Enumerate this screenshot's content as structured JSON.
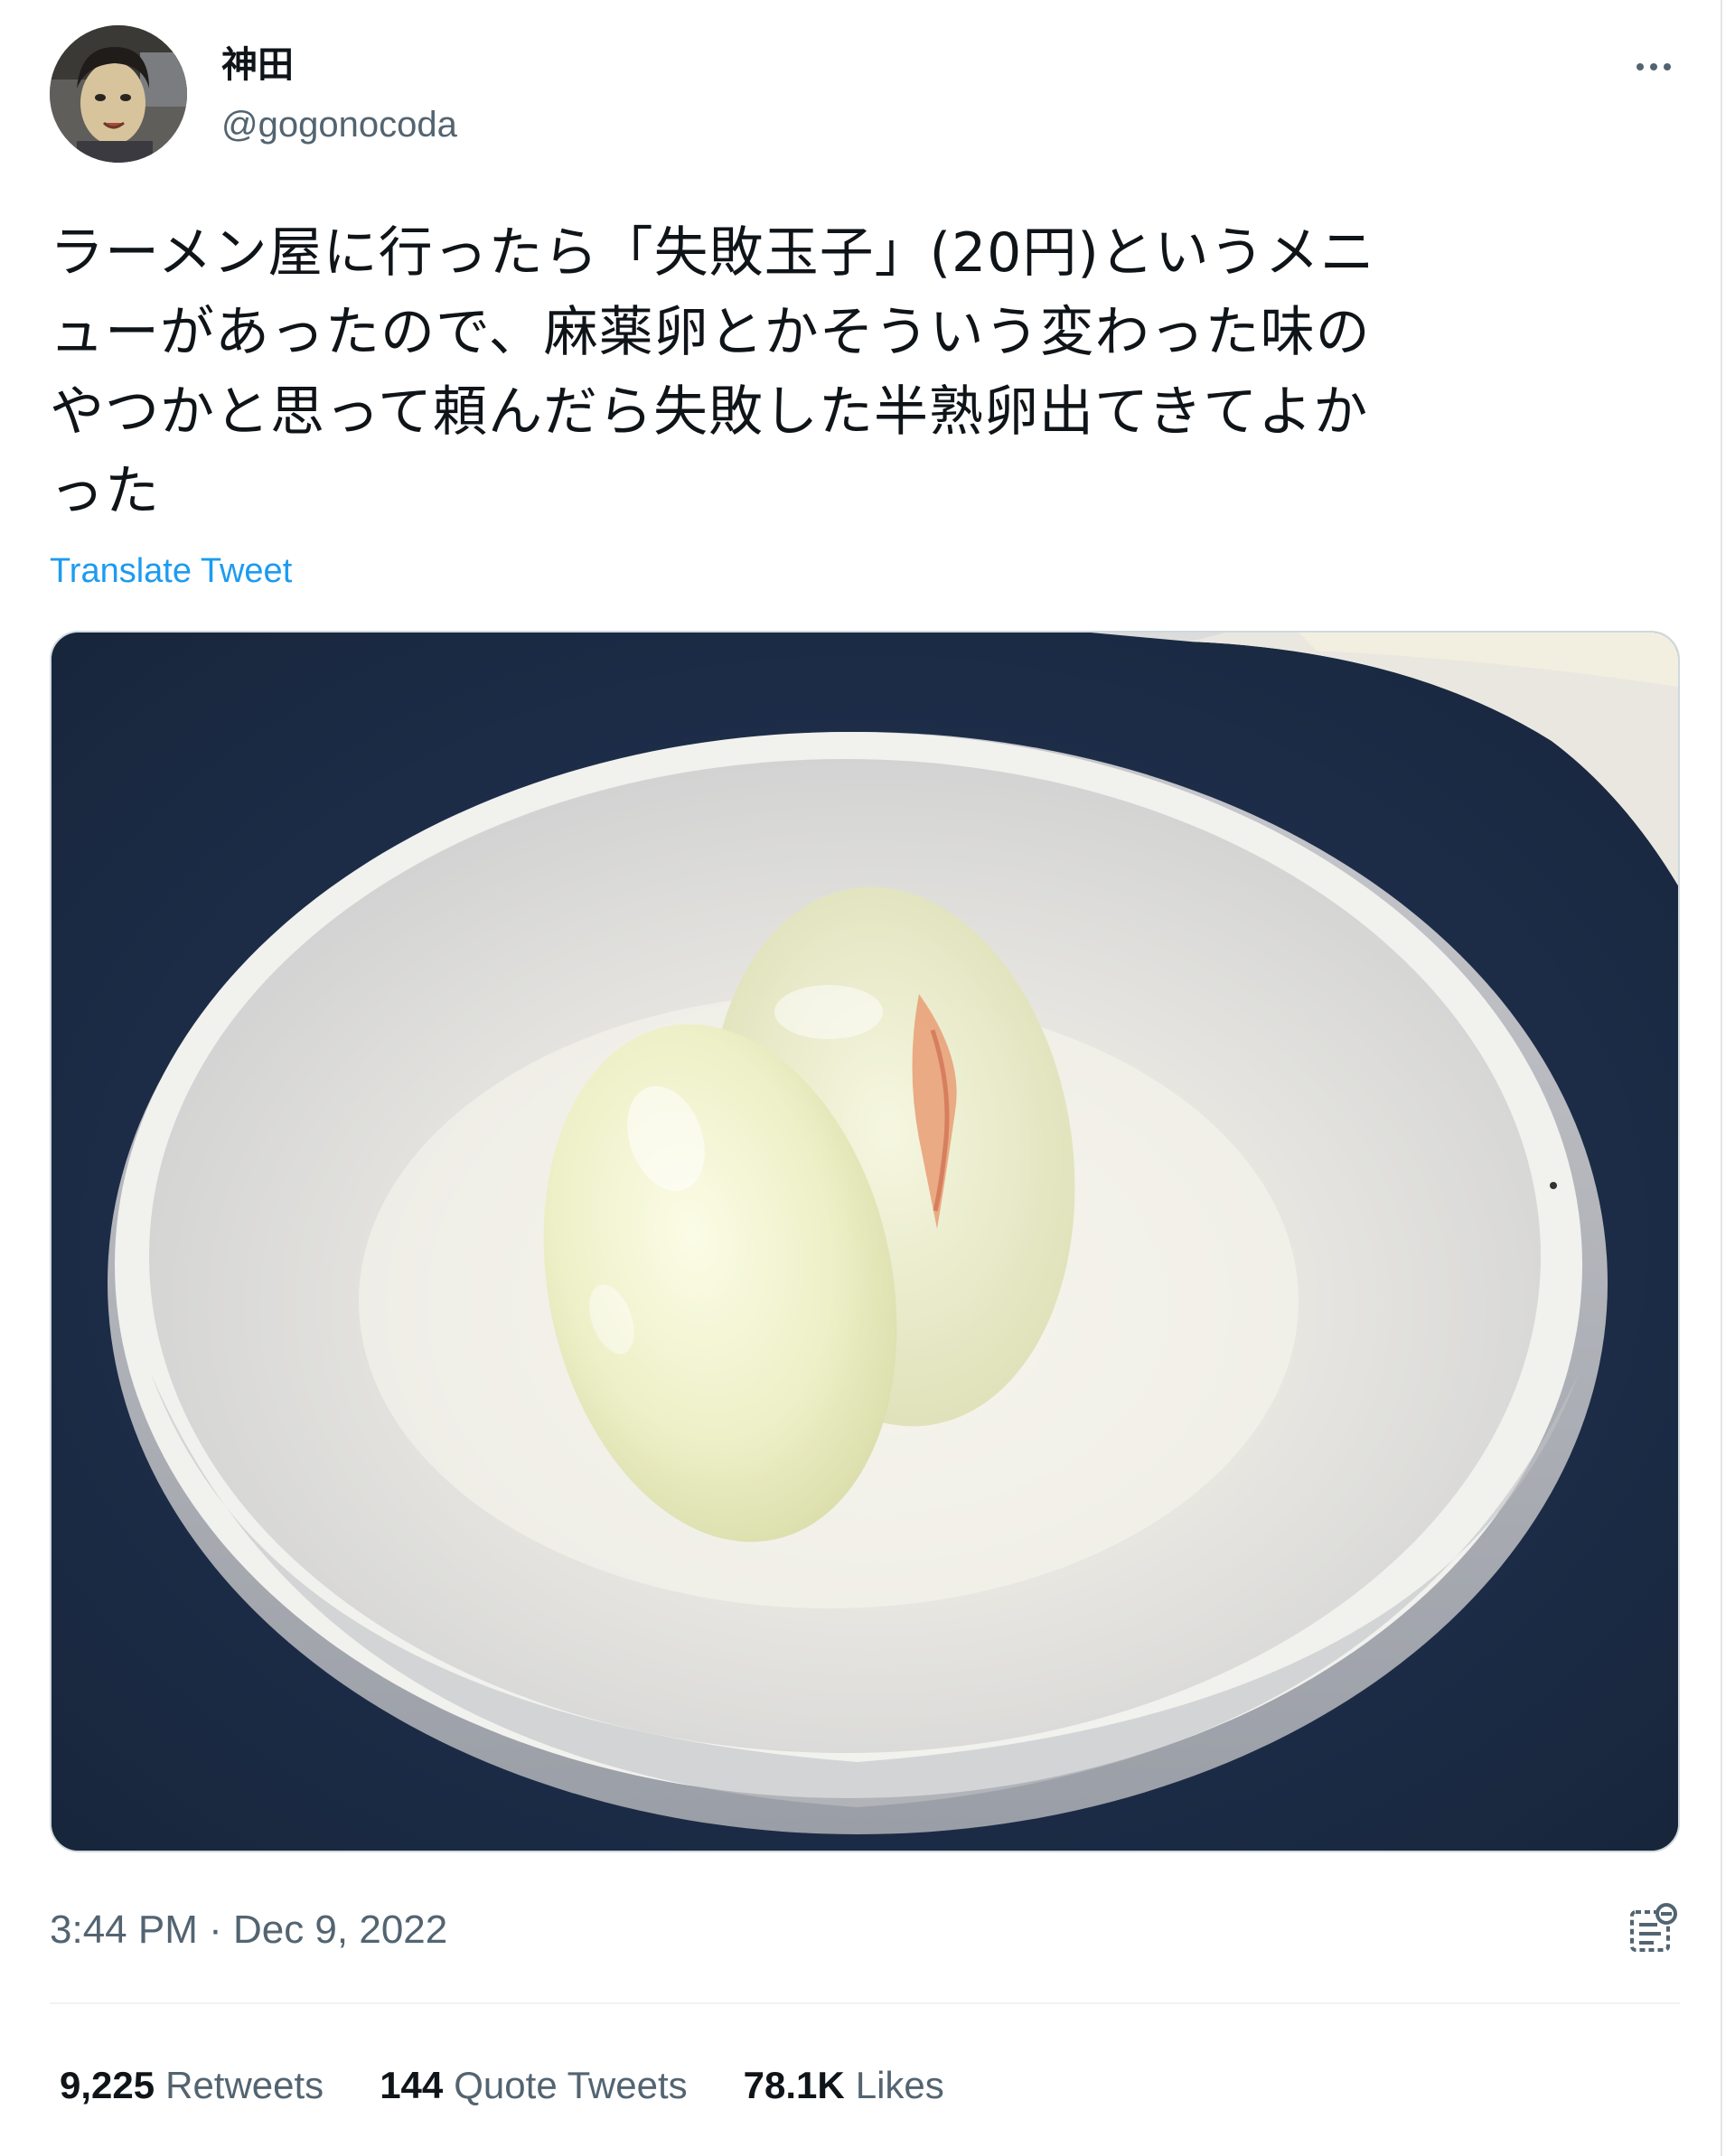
{
  "author": {
    "display_name": "神田",
    "handle": "@gogonocoda"
  },
  "tweet": {
    "lines": [
      "ラーメン屋に行ったら「失敗玉子」(20円)というメニ",
      "ューがあったので、麻薬卵とかそういう変わった味の",
      "やつかと思って頼んだら失敗した半熟卵出てきてよか",
      "った"
    ],
    "translate_label": "Translate Tweet",
    "timestamp": "3:44 PM · Dec 9, 2022"
  },
  "stats": [
    {
      "value": "9,225",
      "label": "Retweets"
    },
    {
      "value": "144",
      "label": "Quote Tweets"
    },
    {
      "value": "78.1K",
      "label": "Likes"
    }
  ],
  "icons": {
    "more": "more-horizontal-icon",
    "analytics": "analytics-icon"
  },
  "colors": {
    "link": "#1d9bf0",
    "secondary_text": "#536471",
    "primary_text": "#0f1419"
  }
}
